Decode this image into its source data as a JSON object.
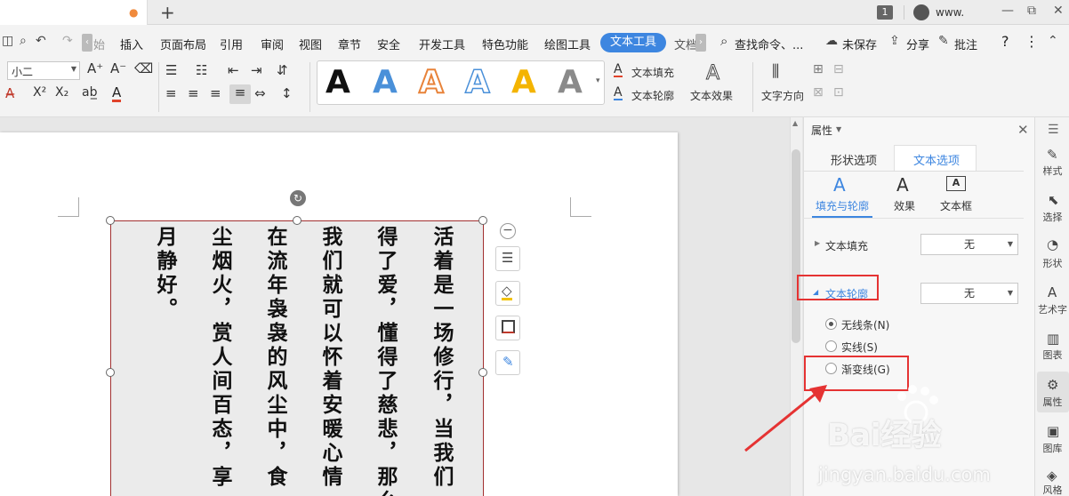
{
  "titlebar": {
    "page_count": "1",
    "user_name": "www.",
    "min": "—",
    "restore": "⧉",
    "close": "✕",
    "new_tab": "+",
    "dot": "●"
  },
  "menu": {
    "items": [
      "插入",
      "页面布局",
      "引用",
      "审阅",
      "视图",
      "章节",
      "安全",
      "开发工具",
      "特色功能",
      "绘图工具"
    ],
    "partial_left": "始",
    "active": "文本工具",
    "partial_right": "文档",
    "search": "查找命令、...",
    "unsaved": "未保存",
    "share": "分享",
    "comment": "批注",
    "help": "?",
    "more": "⋮"
  },
  "ribbon": {
    "font_size": "小二",
    "text_fill": "文本填充",
    "text_outline": "文本轮廓",
    "text_effect": "文本效果",
    "text_direction": "文字方向",
    "art_letter": "A"
  },
  "art_colors": [
    "#111111",
    "#4a90d9",
    "#e8833a",
    "#4a90d9",
    "#f4b400",
    "#777777"
  ],
  "textbox": {
    "columns": [
      "活着是一场修行，当我们",
      "得了爱，懂得了慈悲，那么",
      "我们就可以怀着安暖心情",
      "在流年袅袅的风尘中，食",
      "尘烟火，赏人间百态，享",
      "月静好。"
    ]
  },
  "panel": {
    "title": "属性",
    "tab_shape": "形状选项",
    "tab_text": "文本选项",
    "sub_fill_outline": "填充与轮廓",
    "sub_effect": "效果",
    "sub_textbox": "文本框",
    "text_fill_label": "文本填充",
    "text_fill_value": "无",
    "text_outline_label": "文本轮廓",
    "text_outline_value": "无",
    "opt_none": "无线条(N)",
    "opt_solid": "实线(S)",
    "opt_gradient": "渐变线(G)"
  },
  "sidebar": {
    "items": [
      "样式",
      "选择",
      "形状",
      "艺术字",
      "图表",
      "属性",
      "图库",
      "风格"
    ]
  },
  "watermark": {
    "brand": "Bai经验",
    "url": "jingyan.baidu.com"
  }
}
